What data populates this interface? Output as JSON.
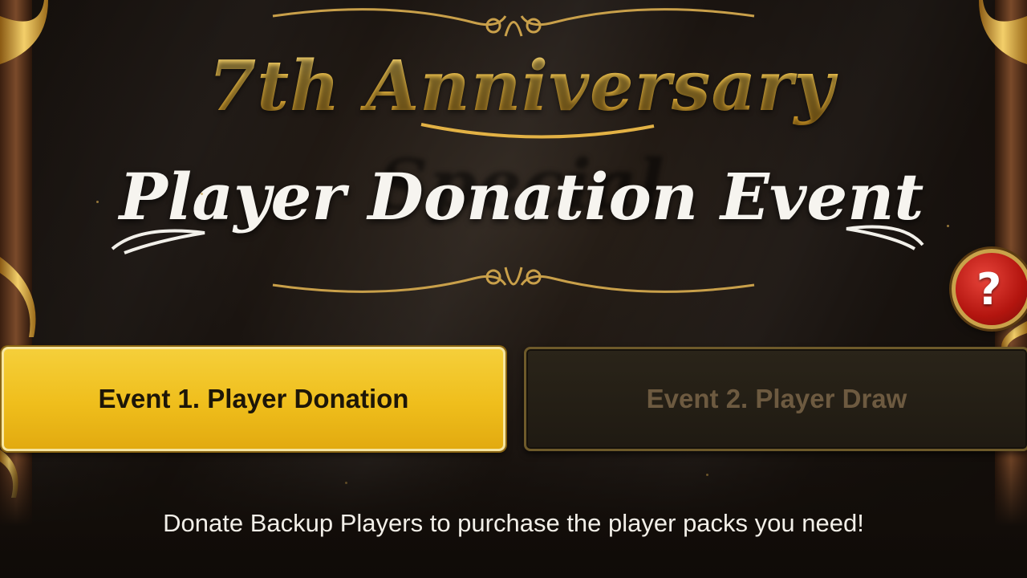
{
  "banner": {
    "title_line1": "7th Anniversary Special",
    "title_line2": "Player Donation Event"
  },
  "help_button": {
    "label": "?",
    "icon": "question-mark-icon"
  },
  "tabs": [
    {
      "label": "Event 1. Player Donation",
      "selected": true
    },
    {
      "label": "Event 2. Player Draw",
      "selected": false
    }
  ],
  "description": "Donate Backup Players to purchase the player packs you need!",
  "colors": {
    "gold": "#efbe1c",
    "title_gold": "#f0c24a",
    "help_red": "#b3150f",
    "background": "#1a1410"
  }
}
